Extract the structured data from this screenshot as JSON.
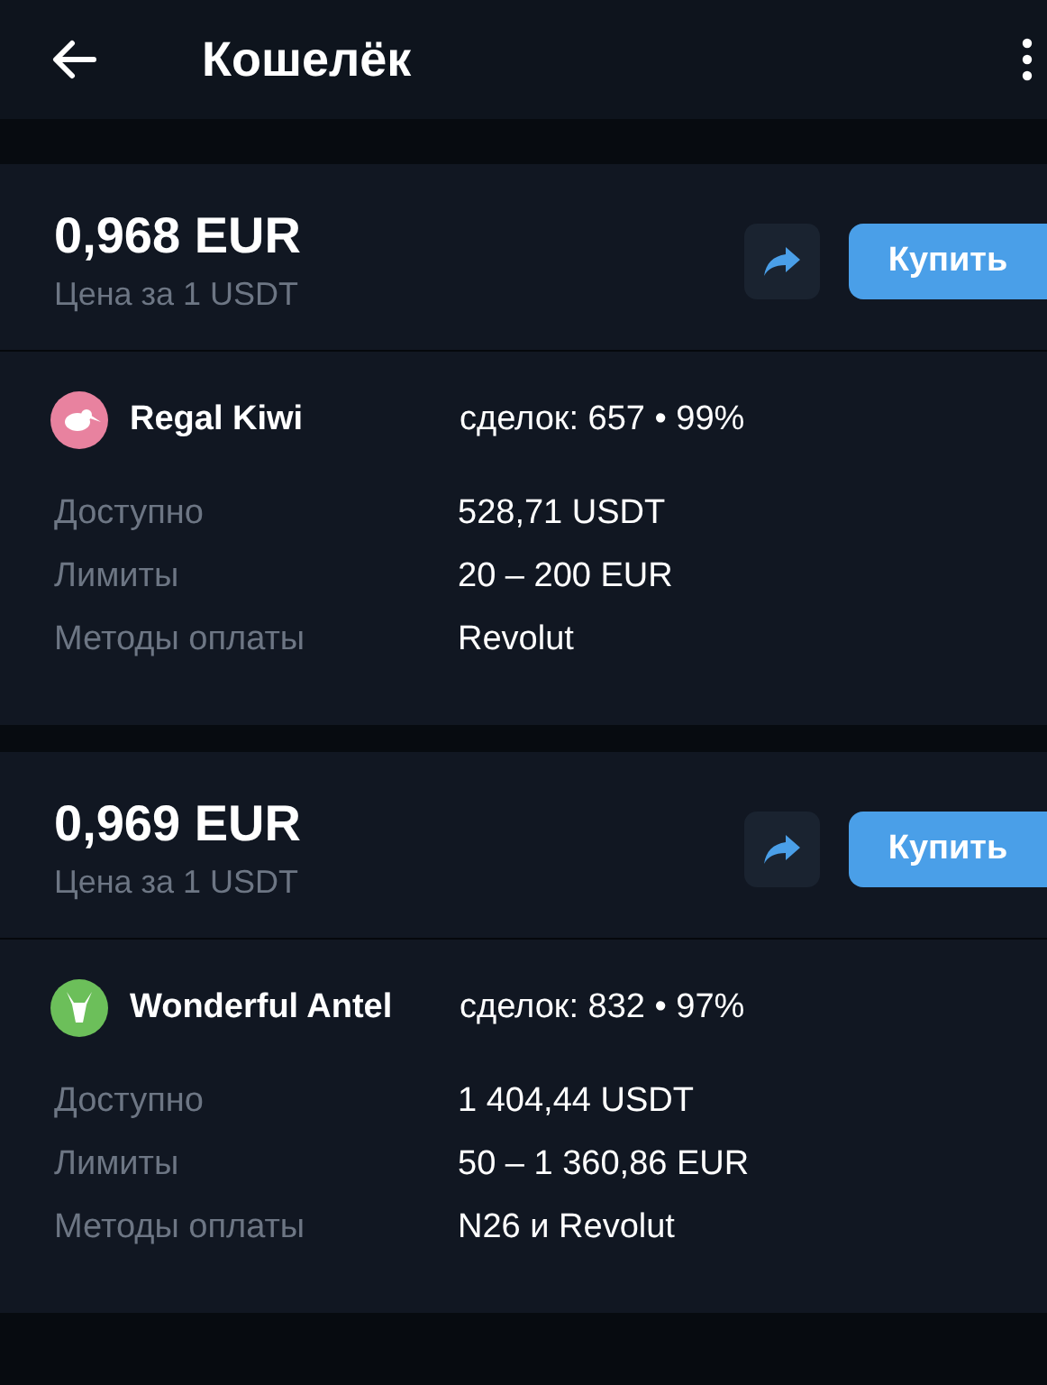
{
  "header": {
    "title": "Кошелёк"
  },
  "offers": [
    {
      "price": "0,968 EUR",
      "price_caption": "Цена за 1 USDT",
      "buy_label": "Купить",
      "seller": {
        "name": "Regal Kiwi",
        "color": "#e8829f",
        "kind": "kiwi"
      },
      "stats": "сделок: 657 • 99%",
      "details": [
        {
          "label": "Доступно",
          "value": "528,71 USDT"
        },
        {
          "label": "Лимиты",
          "value": "20 – 200 EUR"
        },
        {
          "label": "Методы оплаты",
          "value": "Revolut"
        }
      ]
    },
    {
      "price": "0,969 EUR",
      "price_caption": "Цена за 1 USDT",
      "buy_label": "Купить",
      "seller": {
        "name": "Wonderful Antel",
        "color": "#6cbf5a",
        "kind": "antelope"
      },
      "stats": "сделок: 832 • 97%",
      "details": [
        {
          "label": "Доступно",
          "value": "1 404,44 USDT"
        },
        {
          "label": "Лимиты",
          "value": "50 – 1 360,86 EUR"
        },
        {
          "label": "Методы оплаты",
          "value": "N26 и Revolut"
        }
      ]
    }
  ]
}
